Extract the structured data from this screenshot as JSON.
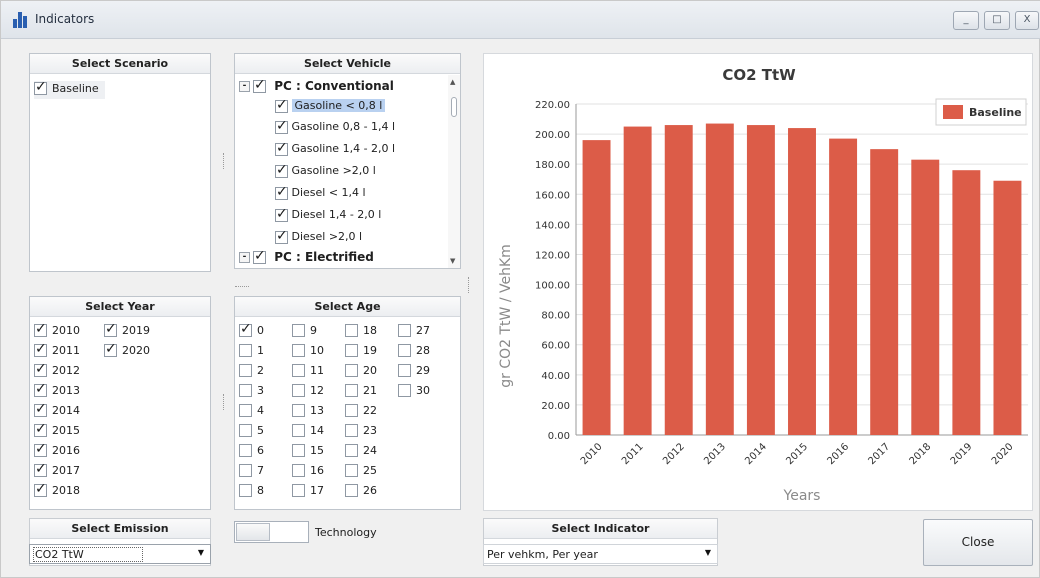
{
  "window": {
    "title": "Indicators",
    "minimize_glyph": "_",
    "maximize_glyph": "□",
    "close_glyph": "X"
  },
  "scenario": {
    "title": "Select Scenario",
    "items": [
      {
        "label": "Baseline",
        "checked": true
      }
    ]
  },
  "vehicle": {
    "title": "Select Vehicle",
    "groups": [
      {
        "label": "PC : Conventional",
        "checked": true,
        "expanded": true
      },
      {
        "label": "PC : Electrified",
        "checked": true,
        "expanded": true
      }
    ],
    "items": [
      {
        "label": "Gasoline < 0,8 l",
        "checked": true,
        "selected": true
      },
      {
        "label": "Gasoline 0,8 - 1,4 l",
        "checked": true
      },
      {
        "label": "Gasoline 1,4 - 2,0 l",
        "checked": true
      },
      {
        "label": "Gasoline >2,0 l",
        "checked": true
      },
      {
        "label": "Diesel < 1,4 l",
        "checked": true
      },
      {
        "label": "Diesel 1,4 - 2,0 l",
        "checked": true
      },
      {
        "label": "Diesel >2,0 l",
        "checked": true
      }
    ]
  },
  "year": {
    "title": "Select Year",
    "items": [
      {
        "label": "2010",
        "checked": true
      },
      {
        "label": "2011",
        "checked": true
      },
      {
        "label": "2012",
        "checked": true
      },
      {
        "label": "2013",
        "checked": true
      },
      {
        "label": "2014",
        "checked": true
      },
      {
        "label": "2015",
        "checked": true
      },
      {
        "label": "2016",
        "checked": true
      },
      {
        "label": "2017",
        "checked": true
      },
      {
        "label": "2018",
        "checked": true
      },
      {
        "label": "2019",
        "checked": true
      },
      {
        "label": "2020",
        "checked": true
      }
    ]
  },
  "age": {
    "title": "Select Age",
    "items": [
      {
        "label": "0",
        "checked": true
      },
      {
        "label": "1",
        "checked": false
      },
      {
        "label": "2",
        "checked": false
      },
      {
        "label": "3",
        "checked": false
      },
      {
        "label": "4",
        "checked": false
      },
      {
        "label": "5",
        "checked": false
      },
      {
        "label": "6",
        "checked": false
      },
      {
        "label": "7",
        "checked": false
      },
      {
        "label": "8",
        "checked": false
      },
      {
        "label": "9",
        "checked": false
      },
      {
        "label": "10",
        "checked": false
      },
      {
        "label": "11",
        "checked": false
      },
      {
        "label": "12",
        "checked": false
      },
      {
        "label": "13",
        "checked": false
      },
      {
        "label": "14",
        "checked": false
      },
      {
        "label": "15",
        "checked": false
      },
      {
        "label": "16",
        "checked": false
      },
      {
        "label": "17",
        "checked": false
      },
      {
        "label": "18",
        "checked": false
      },
      {
        "label": "19",
        "checked": false
      },
      {
        "label": "20",
        "checked": false
      },
      {
        "label": "21",
        "checked": false
      },
      {
        "label": "22",
        "checked": false
      },
      {
        "label": "23",
        "checked": false
      },
      {
        "label": "24",
        "checked": false
      },
      {
        "label": "25",
        "checked": false
      },
      {
        "label": "26",
        "checked": false
      },
      {
        "label": "27",
        "checked": false
      },
      {
        "label": "28",
        "checked": false
      },
      {
        "label": "29",
        "checked": false
      },
      {
        "label": "30",
        "checked": false
      }
    ]
  },
  "emission": {
    "title": "Select Emission",
    "value": "CO2 TtW"
  },
  "technology": {
    "label": "Technology",
    "on": false
  },
  "indicator": {
    "title": "Select Indicator",
    "value": "Per vehkm, Per year"
  },
  "close_button": {
    "label": "Close"
  },
  "colors": {
    "bar": "#dc5c48",
    "accent": "#2a5fb0"
  },
  "chart_data": {
    "type": "bar",
    "title": "CO2 TtW",
    "xlabel": "Years",
    "ylabel": "gr CO2 TtW / VehKm",
    "categories": [
      "2010",
      "2011",
      "2012",
      "2013",
      "2014",
      "2015",
      "2016",
      "2017",
      "2018",
      "2019",
      "2020"
    ],
    "series": [
      {
        "name": "Baseline",
        "values": [
          196,
          205,
          206,
          207,
          206,
          204,
          197,
          190,
          183,
          176,
          169
        ]
      }
    ],
    "ylim": [
      0,
      220
    ],
    "yticks": [
      "0.00",
      "20.00",
      "40.00",
      "60.00",
      "80.00",
      "100.00",
      "120.00",
      "140.00",
      "160.00",
      "180.00",
      "200.00",
      "220.00"
    ],
    "grid": true,
    "legend_position": "top-right"
  }
}
